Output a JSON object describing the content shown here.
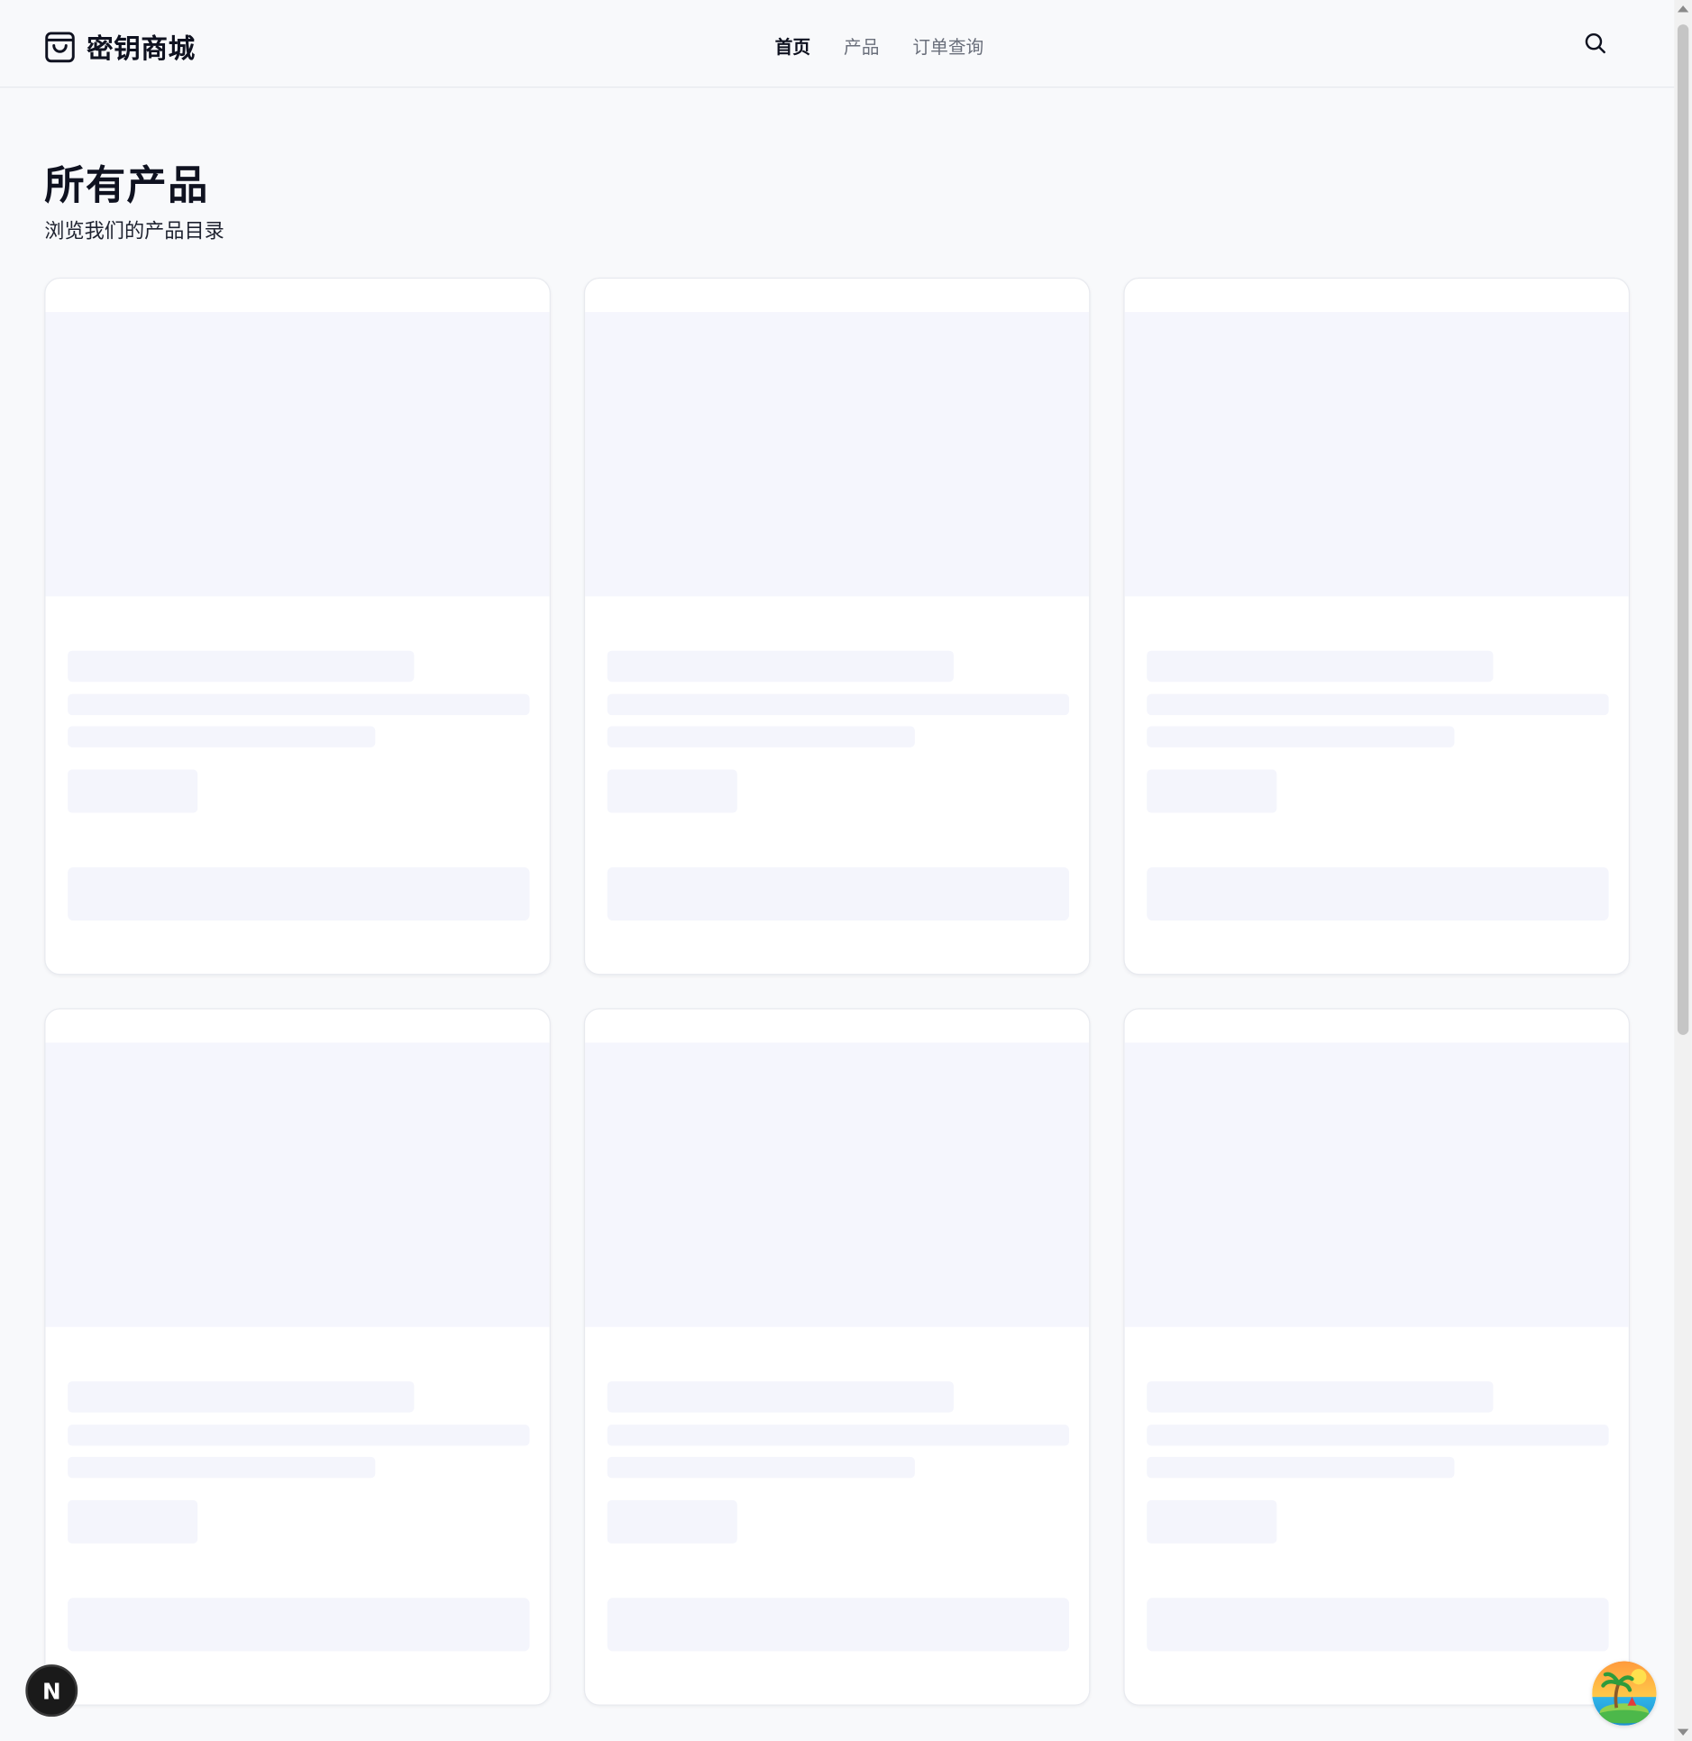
{
  "header": {
    "brand_name": "密钥商城",
    "brand_icon": "shopping-bag-icon",
    "nav": [
      {
        "label": "首页",
        "active": true
      },
      {
        "label": "产品",
        "active": false
      },
      {
        "label": "订单查询",
        "active": false
      }
    ],
    "search_icon": "search-icon"
  },
  "main": {
    "title": "所有产品",
    "subtitle": "浏览我们的产品目录",
    "loading_cards": 6
  },
  "floating": {
    "dev_badge": "N",
    "assistant_icon": "tropical-island-icon"
  },
  "colors": {
    "background": "#f8f9fb",
    "card": "#ffffff",
    "skeleton": "#f4f5fc",
    "text": "#0f1220",
    "nav_muted": "#6a6f7b"
  }
}
